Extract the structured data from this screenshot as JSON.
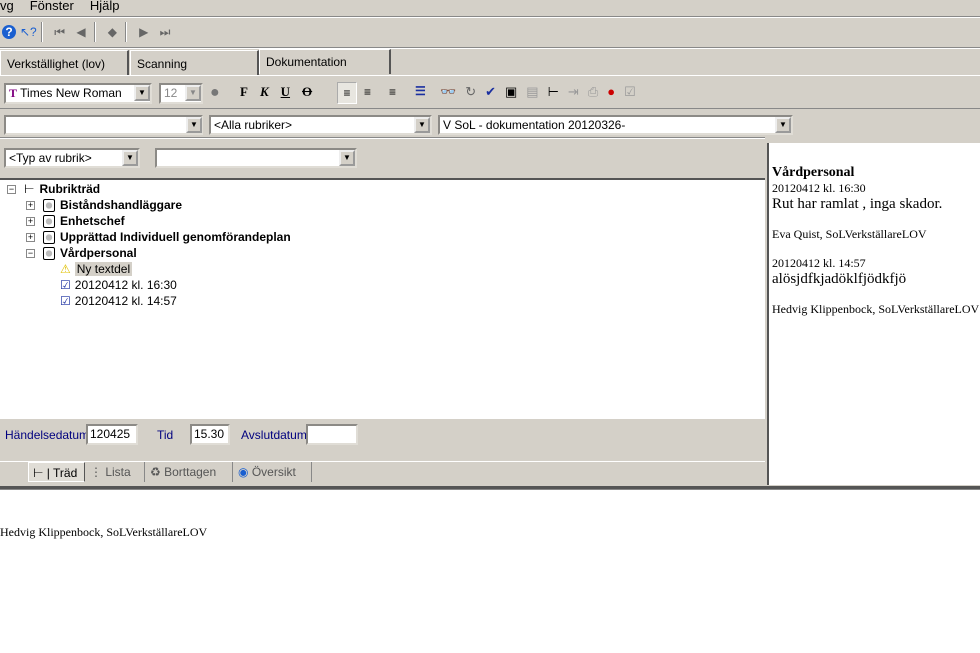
{
  "menu": {
    "items": [
      "vg",
      "Fönster",
      "Hjälp"
    ]
  },
  "toolbar": {
    "icons": [
      "help-icon",
      "whats-this-icon",
      "first-record-icon",
      "prev-record-icon",
      "current-record-icon",
      "next-record-icon",
      "last-record-icon"
    ]
  },
  "tabs": [
    {
      "label": "Verkställighet (lov)"
    },
    {
      "label": "Scanning"
    },
    {
      "label": "Dokumentation",
      "active": true
    }
  ],
  "format": {
    "font": "Times New Roman",
    "size": "12",
    "bold": "F",
    "italic": "K",
    "underline": "U",
    "strike": "O"
  },
  "filters": {
    "combo1": "",
    "combo2": "<Alla rubriker>",
    "combo3": "V SoL - dokumentation 20120326-",
    "type": "<Typ av rubrik>",
    "type2": ""
  },
  "tree": {
    "root": "Rubrikträd",
    "nodes": [
      "Biståndshandläggare",
      "Enhetschef",
      "Upprättad Individuell genomförandeplan",
      "Vårdpersonal"
    ],
    "children": [
      "Ny textdel",
      "20120412  kl. 16:30",
      "20120412  kl. 14:57"
    ]
  },
  "fields": {
    "date_label": "Händelsedatum",
    "date": "120425",
    "time_label": "Tid",
    "time": "15.30",
    "end_label": "Avslutdatum",
    "end": ""
  },
  "bottom_tabs": [
    "Träd",
    "Lista",
    "Borttagen",
    "Översikt"
  ],
  "preview": {
    "heading": "Vårdpersonal",
    "e1_date": "20120412 kl. 16:30",
    "e1_text": "Rut har ramlat , inga skador.",
    "e1_sign": "Eva Quist, SoLVerkställareLOV",
    "e2_date": "20120412 kl. 14:57",
    "e2_text": "alösjdfkjadöklfjödkfjö",
    "e2_sign": "Hedvig Klippenbock, SoLVerkställareLOV"
  },
  "editor": {
    "text": "Hedvig Klippenbock, SoLVerkställareLOV"
  }
}
